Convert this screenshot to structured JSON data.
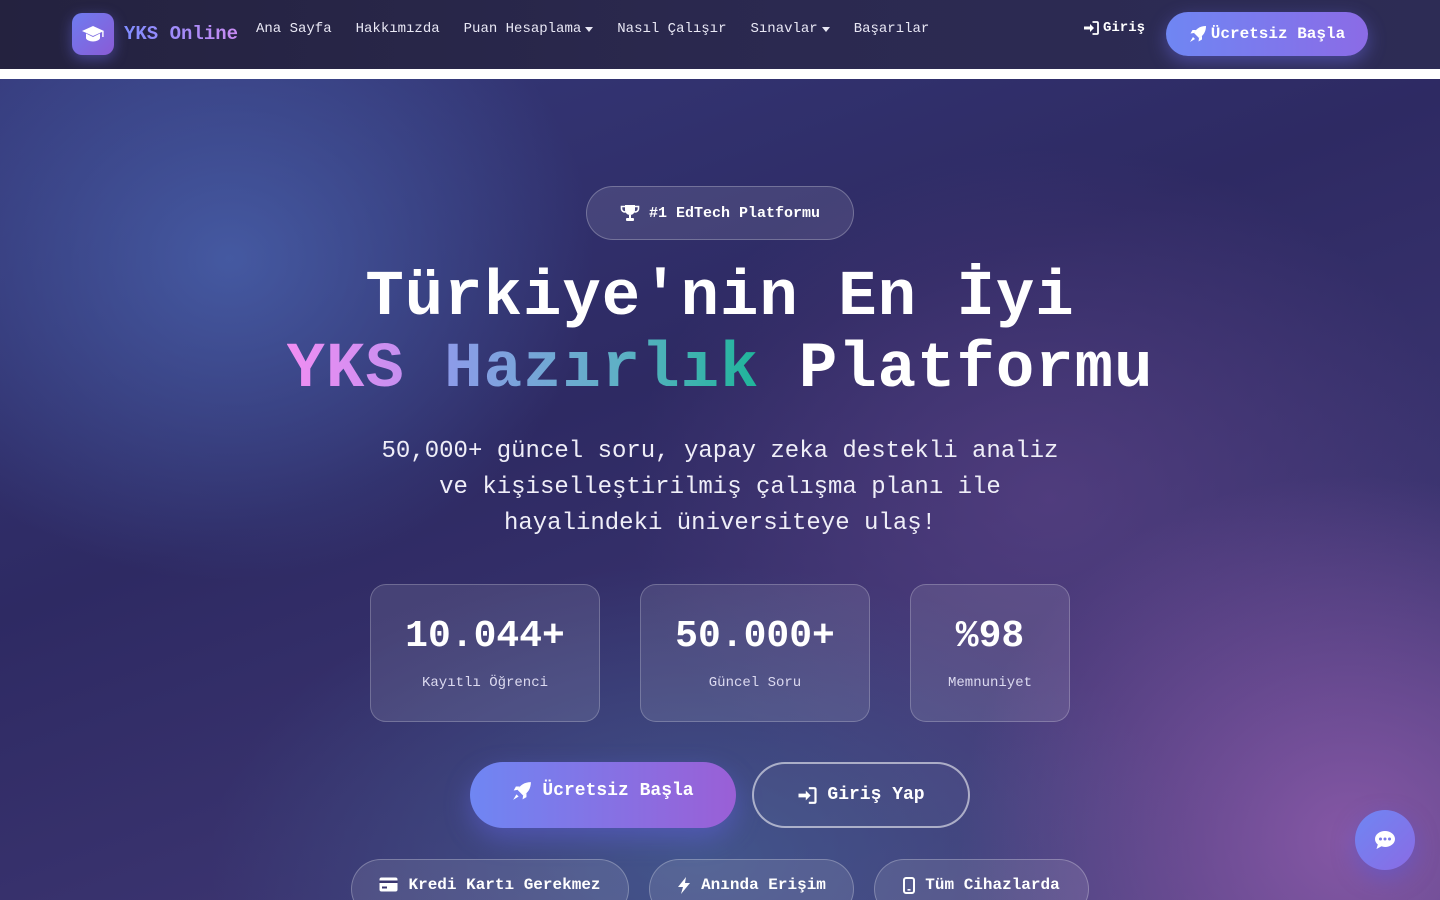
{
  "nav": {
    "brand": "YKS Online",
    "brand_icon": "graduation-cap-icon",
    "links": [
      {
        "label": "Ana Sayfa",
        "dropdown": false
      },
      {
        "label": "Hakkımızda",
        "dropdown": false
      },
      {
        "label": "Puan Hesaplama",
        "dropdown": true
      },
      {
        "label": "Nasıl Çalışır",
        "dropdown": false
      },
      {
        "label": "Sınavlar",
        "dropdown": true
      },
      {
        "label": "Başarılar",
        "dropdown": false
      }
    ],
    "login_label": "Giriş",
    "cta_label": "Ücretsiz Başla"
  },
  "hero": {
    "badge": "#1 EdTech Platformu",
    "headline_line1": "Türkiye'nin En İyi",
    "headline_accent1": "YKS",
    "headline_accent2": "Hazırlık",
    "headline_rest": "Platformu",
    "subtitle": "50,000+ güncel soru, yapay zeka destekli analiz ve kişiselleştirilmiş çalışma planı ile hayalindeki üniversiteye ulaş!",
    "stats": [
      {
        "value": "10.044+",
        "label": "Kayıtlı Öğrenci"
      },
      {
        "value": "50.000+",
        "label": "Güncel Soru"
      },
      {
        "value": "%98",
        "label": "Memnuniyet"
      }
    ],
    "primary_button": "Ücretsiz Başla",
    "secondary_button": "Giriş Yap",
    "features": [
      {
        "label": "Kredi Kartı Gerekmez",
        "icon": "credit-card-icon"
      },
      {
        "label": "Anında Erişim",
        "icon": "bolt-icon"
      },
      {
        "label": "Tüm Cihazlarda",
        "icon": "mobile-icon"
      }
    ]
  },
  "colors": {
    "primary_gradient_start": "#6f86f3",
    "primary_gradient_end": "#8b6be6",
    "background": "#2e2a63",
    "accent_pink": "#f08ef2",
    "accent_teal": "#1fb59a"
  },
  "chat": {
    "icon": "chat-bubble-icon"
  }
}
